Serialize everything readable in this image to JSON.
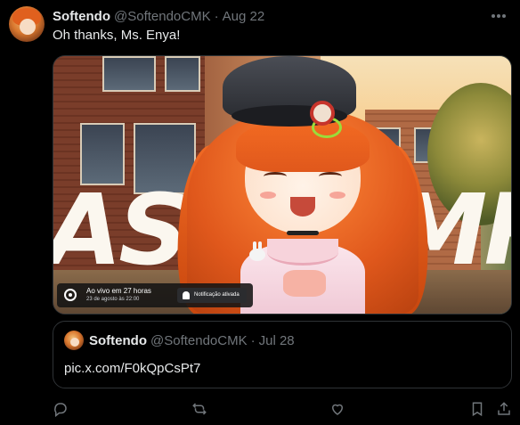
{
  "tweet": {
    "display_name": "Softendo",
    "handle": "@SoftendoCMK",
    "separator": "·",
    "time": "Aug 22",
    "text": "Oh thanks, Ms. Enya!"
  },
  "media": {
    "overlay_word_left": "AS",
    "overlay_word_right": "MR",
    "live": {
      "status": "Ao vivo em 27 horas",
      "datetime": "23 de agosto às 22:00",
      "notification_label": "Notificação ativada"
    }
  },
  "quote": {
    "display_name": "Softendo",
    "handle": "@SoftendoCMK",
    "separator": "·",
    "time": "Jul 28",
    "text": "pic.x.com/F0kQpCsPt7"
  },
  "actions": {
    "icons": [
      "reply-icon",
      "retweet-icon",
      "like-icon",
      "bookmark-icon",
      "share-icon"
    ]
  },
  "colors": {
    "background": "#000000",
    "text_primary": "#e7e9ea",
    "text_secondary": "#71767b",
    "border": "#2f3336"
  }
}
